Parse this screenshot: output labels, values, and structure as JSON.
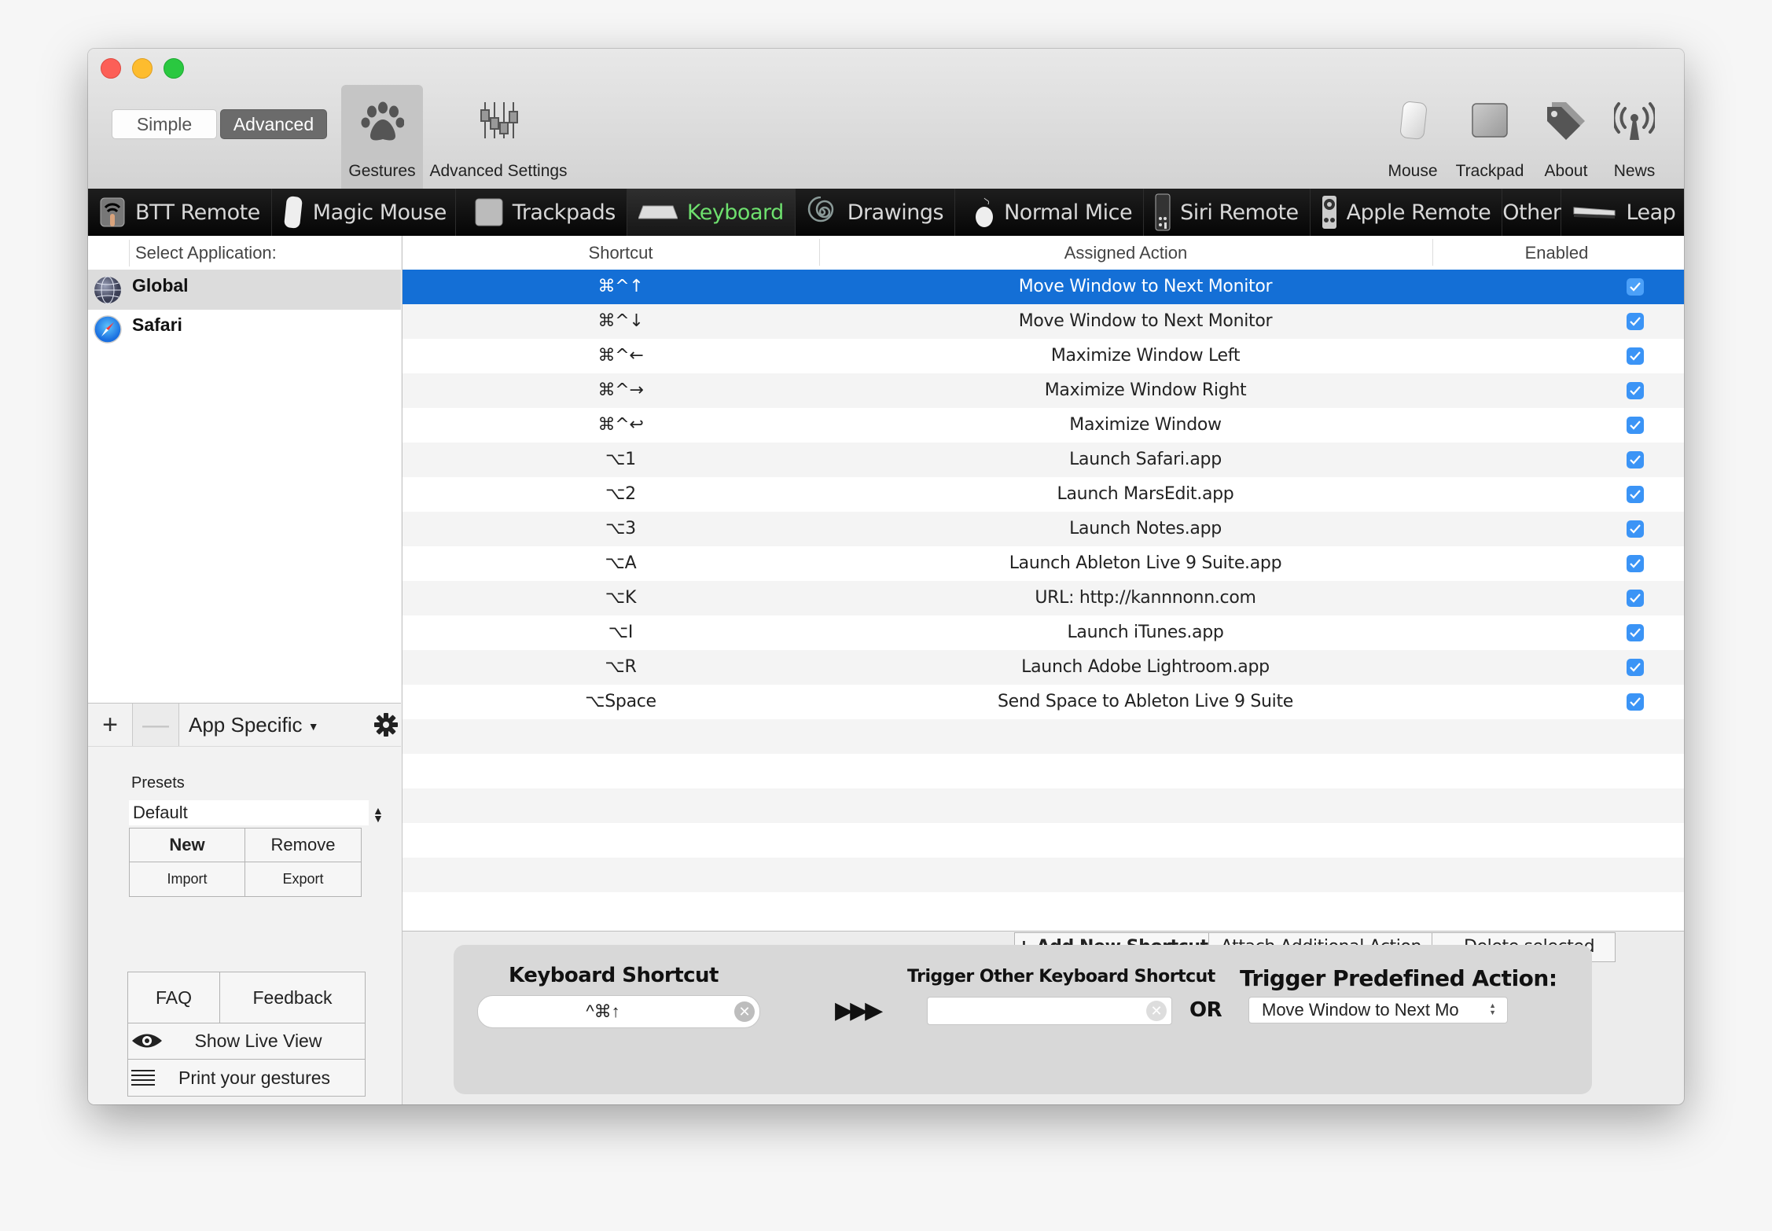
{
  "window": {
    "mode_toggle": {
      "simple": "Simple",
      "advanced": "Advanced",
      "selected": "Advanced"
    },
    "toolbar_left": [
      {
        "label": "Gestures",
        "icon": "paw-icon",
        "active": true
      },
      {
        "label": "Advanced Settings",
        "icon": "sliders-icon",
        "active": false
      }
    ],
    "toolbar_right": [
      {
        "label": "Mouse",
        "icon": "magic-mouse-icon"
      },
      {
        "label": "Trackpad",
        "icon": "trackpad-icon"
      },
      {
        "label": "About",
        "icon": "tag-icon"
      },
      {
        "label": "News",
        "icon": "antenna-icon"
      }
    ]
  },
  "tabs": [
    {
      "label": "BTT Remote",
      "icon": "btt-remote-icon"
    },
    {
      "label": "Magic Mouse",
      "icon": "magic-mouse-icon"
    },
    {
      "label": "Trackpads",
      "icon": "trackpad-icon"
    },
    {
      "label": "Keyboard",
      "icon": "keyboard-icon",
      "active": true
    },
    {
      "label": "Drawings",
      "icon": "spiral-icon"
    },
    {
      "label": "Normal Mice",
      "icon": "mouse-icon"
    },
    {
      "label": "Siri Remote",
      "icon": "siri-remote-icon"
    },
    {
      "label": "Apple Remote",
      "icon": "apple-remote-icon"
    },
    {
      "label": "Other",
      "icon": ""
    },
    {
      "label": "Leap",
      "icon": "leap-motion-icon"
    }
  ],
  "sidebar": {
    "header": "Select Application:",
    "apps": [
      {
        "name": "Global",
        "icon": "globe-icon",
        "selected": true
      },
      {
        "name": "Safari",
        "icon": "safari-compass-icon",
        "selected": false
      }
    ],
    "add_label": "+",
    "remove_label": "—",
    "scope_menu": "App Specific",
    "presets_label": "Presets",
    "preset_value": "Default",
    "preset_buttons": {
      "new": "New",
      "remove": "Remove",
      "import": "Import",
      "export": "Export"
    },
    "help_buttons": {
      "faq": "FAQ",
      "feedback": "Feedback",
      "live_view": "Show Live View",
      "print": "Print your gestures"
    }
  },
  "table": {
    "columns": [
      "Shortcut",
      "Assigned Action",
      "Enabled"
    ],
    "rows": [
      {
        "shortcut": "⌘^↑",
        "action": "Move Window to Next Monitor",
        "enabled": true,
        "selected": true
      },
      {
        "shortcut": "⌘^↓",
        "action": "Move Window to Next Monitor",
        "enabled": true
      },
      {
        "shortcut": "⌘^←",
        "action": "Maximize Window Left",
        "enabled": true
      },
      {
        "shortcut": "⌘^→",
        "action": "Maximize Window Right",
        "enabled": true
      },
      {
        "shortcut": "⌘^↩",
        "action": "Maximize Window",
        "enabled": true
      },
      {
        "shortcut": "⌥1",
        "action": "Launch Safari.app",
        "enabled": true
      },
      {
        "shortcut": "⌥2",
        "action": "Launch MarsEdit.app",
        "enabled": true
      },
      {
        "shortcut": "⌥3",
        "action": "Launch Notes.app",
        "enabled": true
      },
      {
        "shortcut": "⌥A",
        "action": "Launch Ableton Live 9 Suite.app",
        "enabled": true
      },
      {
        "shortcut": "⌥K",
        "action": "URL: http://kannnonn.com",
        "enabled": true
      },
      {
        "shortcut": "⌥I",
        "action": "Launch iTunes.app",
        "enabled": true
      },
      {
        "shortcut": "⌥R",
        "action": "Launch Adobe Lightroom.app",
        "enabled": true
      },
      {
        "shortcut": "⌥Space",
        "action": "Send Space to Ableton Live 9 Suite",
        "enabled": true
      }
    ],
    "actions": {
      "add": "+ Add New Shortcut",
      "attach": "Attach Additional Action",
      "delete": "- Delete selected"
    }
  },
  "editor": {
    "shortcut_title": "Keyboard Shortcut",
    "shortcut_value": "^⌘↑",
    "arrows": "▶▶▶",
    "trigger_title": "Trigger Other Keyboard Shortcut",
    "trigger_value": "",
    "or_label": "OR",
    "predefined_title": "Trigger Predefined Action:",
    "predefined_value": "Move Window to Next Mo"
  },
  "colors": {
    "selection": "#146fd6",
    "checkbox": "#3b94f6",
    "active_tab": "#6ee06e"
  }
}
